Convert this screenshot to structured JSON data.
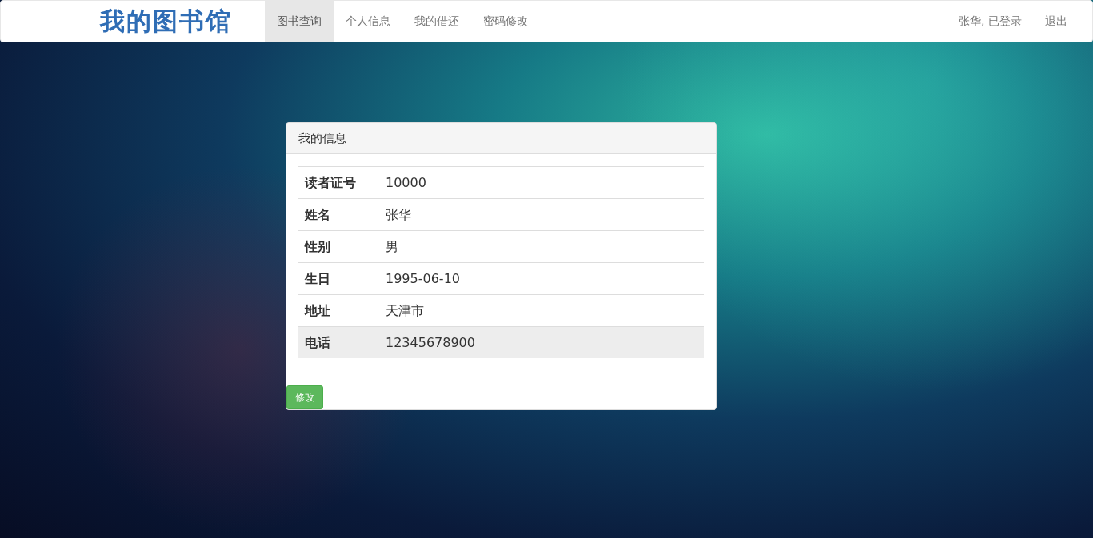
{
  "navbar": {
    "logo": "我的图书馆",
    "tabs": [
      {
        "label": "图书查询",
        "selected": true
      },
      {
        "label": "个人信息",
        "selected": false
      },
      {
        "label": "我的借还",
        "selected": false
      },
      {
        "label": "密码修改",
        "selected": false
      }
    ],
    "user_status": "张华, 已登录",
    "logout": "退出"
  },
  "panel": {
    "title": "我的信息",
    "rows": [
      {
        "label": "读者证号",
        "value": "10000",
        "highlighted": false
      },
      {
        "label": "姓名",
        "value": "张华",
        "highlighted": false
      },
      {
        "label": "性别",
        "value": "男",
        "highlighted": false
      },
      {
        "label": "生日",
        "value": "1995-06-10",
        "highlighted": false
      },
      {
        "label": "地址",
        "value": "天津市",
        "highlighted": false
      },
      {
        "label": "电话",
        "value": "12345678900",
        "highlighted": true
      }
    ],
    "button": "修改"
  }
}
